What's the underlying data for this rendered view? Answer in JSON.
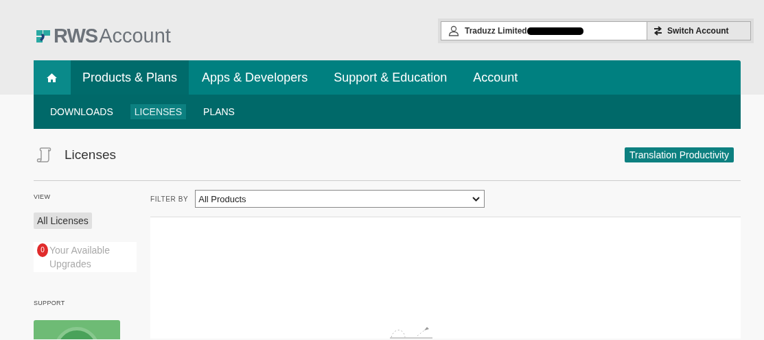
{
  "logo": {
    "brand": "RWS",
    "product": "Account"
  },
  "account_bar": {
    "account_name": "Traduzz Limited",
    "switch_button": "Switch Account"
  },
  "main_nav": [
    {
      "kind": "home",
      "selected": false
    },
    {
      "kind": "link",
      "label": "Products & Plans",
      "selected": true
    },
    {
      "kind": "link",
      "label": "Apps & Developers",
      "selected": false
    },
    {
      "kind": "link",
      "label": "Support & Education",
      "selected": false
    },
    {
      "kind": "link",
      "label": "Account",
      "selected": false
    }
  ],
  "sub_nav": [
    {
      "label": "DOWNLOADS",
      "selected": false
    },
    {
      "label": "LICENSES",
      "selected": true
    },
    {
      "label": "PLANS",
      "selected": false
    }
  ],
  "page": {
    "title": "Licenses",
    "product_badge": "Translation Productivity"
  },
  "sidebar": {
    "view_heading": "VIEW",
    "view_items": [
      {
        "label": "All Licenses",
        "selected": true,
        "disabled": false
      },
      {
        "label": "Your Available Upgrades",
        "selected": false,
        "disabled": true,
        "badge": "0"
      }
    ],
    "support_heading": "SUPPORT"
  },
  "filter": {
    "label": "FILTER BY",
    "value": "All Products"
  }
}
